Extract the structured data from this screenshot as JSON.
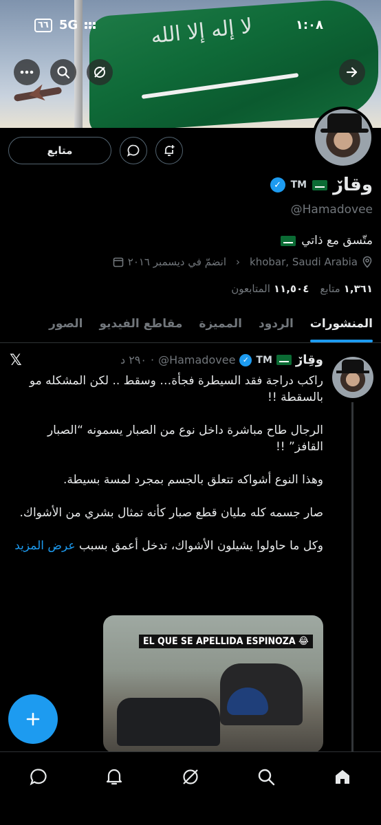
{
  "status_bar": {
    "time": "١:٠٨",
    "network": "5G",
    "sim": "٦٦"
  },
  "profile": {
    "display_name": "وقاڒ",
    "tm": "TM",
    "handle": "@Hamadovee",
    "bio": "متّسق مع ذاتي",
    "location": "khobar, Saudi Arabia",
    "joined": "انضمّ في ديسمبر ٢٠١٦",
    "following_count": "١,٣٦١",
    "following_label": "متابع",
    "followers_count": "١١,٥٠٤",
    "followers_label": "المتابعون",
    "follow_button": "متابع"
  },
  "tabs": [
    {
      "label": "المنشورات",
      "active": true
    },
    {
      "label": "الردود"
    },
    {
      "label": "المميزة"
    },
    {
      "label": "مقاطع الفيديو"
    },
    {
      "label": "الصور"
    }
  ],
  "post": {
    "author_name": "وقِاڒ",
    "tm": "TM",
    "handle": "@Hamadovee",
    "time": "٢٩٠ د",
    "paragraphs": [
      "راكب دراجة فقد السيطرة فجأة… وسقط .. لكن المشكله مو بالسقطة !!",
      "الرجال طاح مباشرة داخل نوع من الصبار يسمونه “الصبار القافز” !!",
      "وهذا النوع أشواكه تتعلق بالجسم بمجرد لمسة بسيطة.",
      "صار جسمه كله مليان قطع صبار كأنه تمثال بشري من الأشواك."
    ],
    "last_paragraph": "وكل ما حاولوا يشيلون الأشواك، تدخل أعمق بسبب",
    "show_more": "عرض المزيد",
    "media_caption": "EL QUE SE APELLIDA ESPINOZA 😂"
  },
  "colors": {
    "accent": "#1d9bf0",
    "muted": "#71767b",
    "border": "#2f3336"
  },
  "icons": [
    "more-icon",
    "search-icon",
    "grok-icon",
    "arrow-right-icon",
    "message-icon",
    "notification-add-icon",
    "verified-icon",
    "location-icon",
    "calendar-icon",
    "x-logo-icon",
    "compose-icon",
    "home-icon",
    "bell-icon"
  ]
}
